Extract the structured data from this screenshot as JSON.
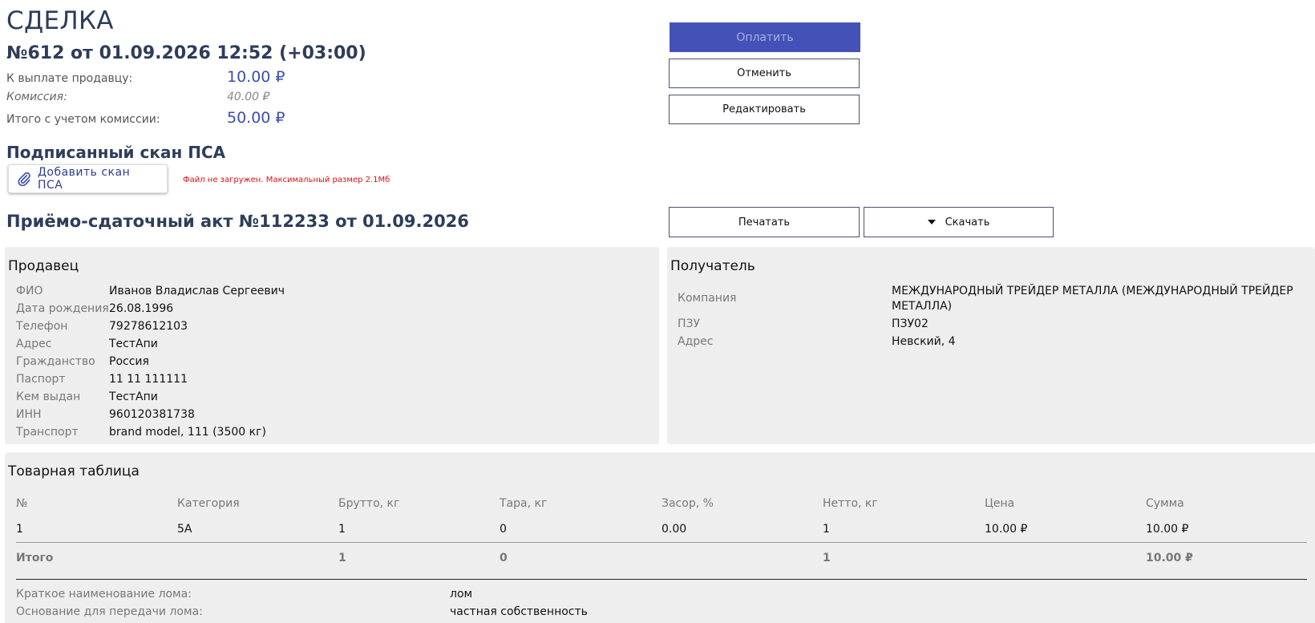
{
  "header": {
    "title": "СДЕЛКА",
    "deal": "№612 от 01.09.2026 12:52 (+03:00)"
  },
  "summary": {
    "to_seller_label": "К выплате продавцу:",
    "to_seller_value": "10.00 ₽",
    "commission_label": "Комиссия:",
    "commission_value": "40.00 ₽",
    "total_label": "Итого с учетом комиссии:",
    "total_value": "50.00 ₽"
  },
  "actions": {
    "pay": "Оплатить",
    "cancel": "Отменить",
    "edit": "Редактировать",
    "print": "Печатать",
    "download": "Скачать"
  },
  "scan": {
    "title": "Подписанный скан ПСА",
    "add_label": "Добавить скан ПСА",
    "error": "Файл не загружен. Максимальный размер 2.1Мб"
  },
  "act": {
    "title": "Приёмо-сдаточный акт №112233 от 01.09.2026"
  },
  "seller": {
    "title": "Продавец",
    "fields": [
      {
        "k": "ФИО",
        "v": "Иванов Владислав Сергеевич"
      },
      {
        "k": "Дата рождения",
        "v": "26.08.1996"
      },
      {
        "k": "Телефон",
        "v": "79278612103"
      },
      {
        "k": "Адрес",
        "v": "ТестАпи"
      },
      {
        "k": "Гражданство",
        "v": "Россия"
      },
      {
        "k": "Паспорт",
        "v": "11 11 111111"
      },
      {
        "k": "Кем выдан",
        "v": "ТестАпи"
      },
      {
        "k": "ИНН",
        "v": "960120381738"
      },
      {
        "k": "Транспорт",
        "v": "brand model, 111 (3500 кг)"
      }
    ]
  },
  "receiver": {
    "title": "Получатель",
    "company_label": "Компания",
    "company_line1": "МЕЖДУНАРОДНЫЙ ТРЕЙДЕР МЕТАЛЛА (МЕЖДУНАРОДНЫЙ ТРЕЙДЕР",
    "company_line2": "МЕТАЛЛА)",
    "pzu_label": "ПЗУ",
    "pzu_value": "ПЗУ02",
    "address_label": "Адрес",
    "address_value": "Невский, 4"
  },
  "goods": {
    "title": "Товарная таблица",
    "columns": [
      "№",
      "Категория",
      "Брутто, кг",
      "Тара, кг",
      "Засор, %",
      "Нетто, кг",
      "Цена",
      "Сумма"
    ],
    "rows": [
      [
        "1",
        "5А",
        "1",
        "0",
        "0.00",
        "1",
        "10.00 ₽",
        "10.00 ₽"
      ]
    ],
    "total": [
      "Итого",
      "",
      "1",
      "0",
      "",
      "1",
      "",
      "10.00 ₽"
    ],
    "short_name_label": "Краткое наименование лома:",
    "short_name_value": "лом",
    "basis_label": "Основание для передачи лома:",
    "basis_value": "частная собственность"
  },
  "colors": {
    "accent": "#4452b8",
    "error": "#e01010",
    "heading": "#2d3d5a",
    "panel": "#eeeeee"
  }
}
